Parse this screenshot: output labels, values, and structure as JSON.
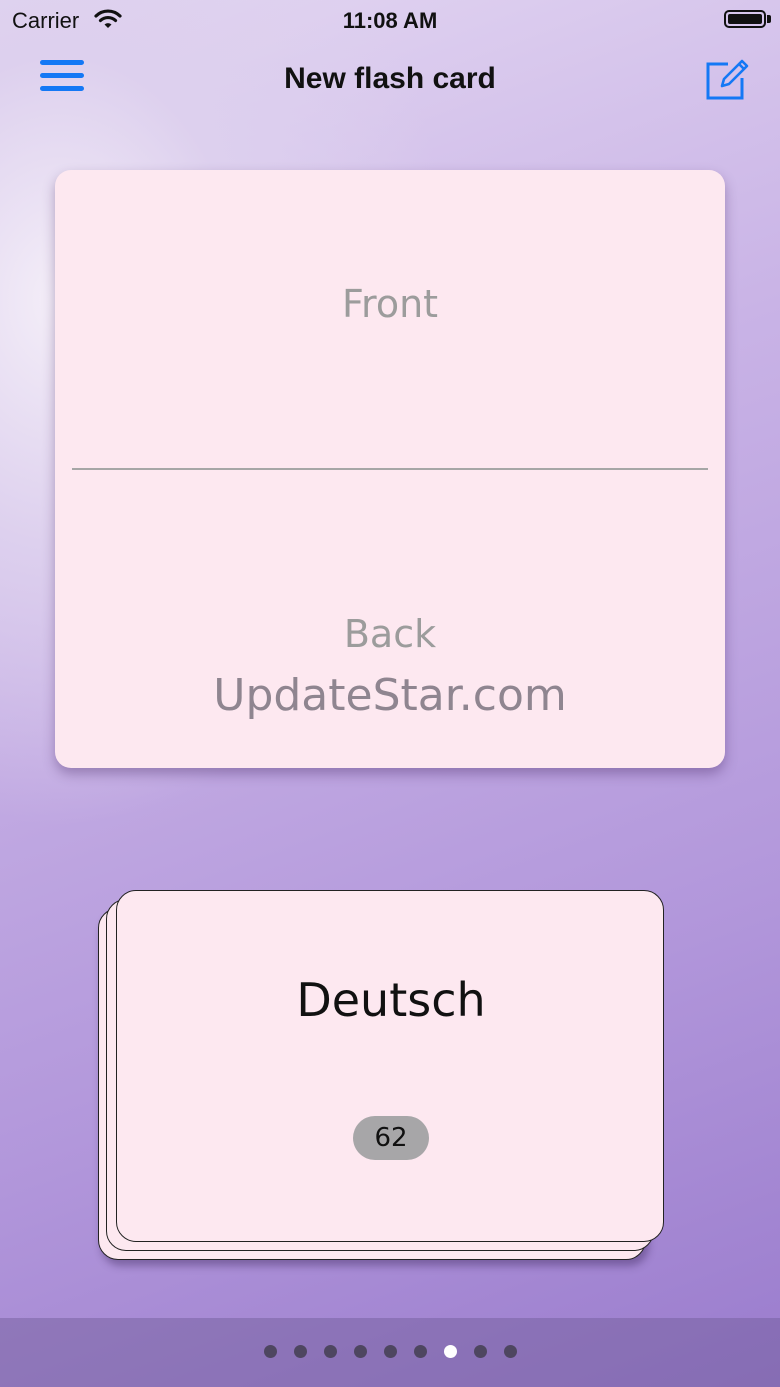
{
  "status_bar": {
    "carrier": "Carrier",
    "time": "11:08 AM",
    "battery_level": 1.0
  },
  "nav": {
    "title": "New flash card",
    "menu_icon": "hamburger-menu-icon",
    "edit_icon": "compose-edit-icon",
    "accent_color": "#1478f5"
  },
  "card": {
    "front_placeholder": "Front",
    "back_placeholder": "Back",
    "watermark": "UpdateStar.com",
    "background_color": "#fde8f0"
  },
  "deck": {
    "name": "Deutsch",
    "count": "62"
  },
  "pager": {
    "total_pages": 9,
    "current_page": 7
  }
}
